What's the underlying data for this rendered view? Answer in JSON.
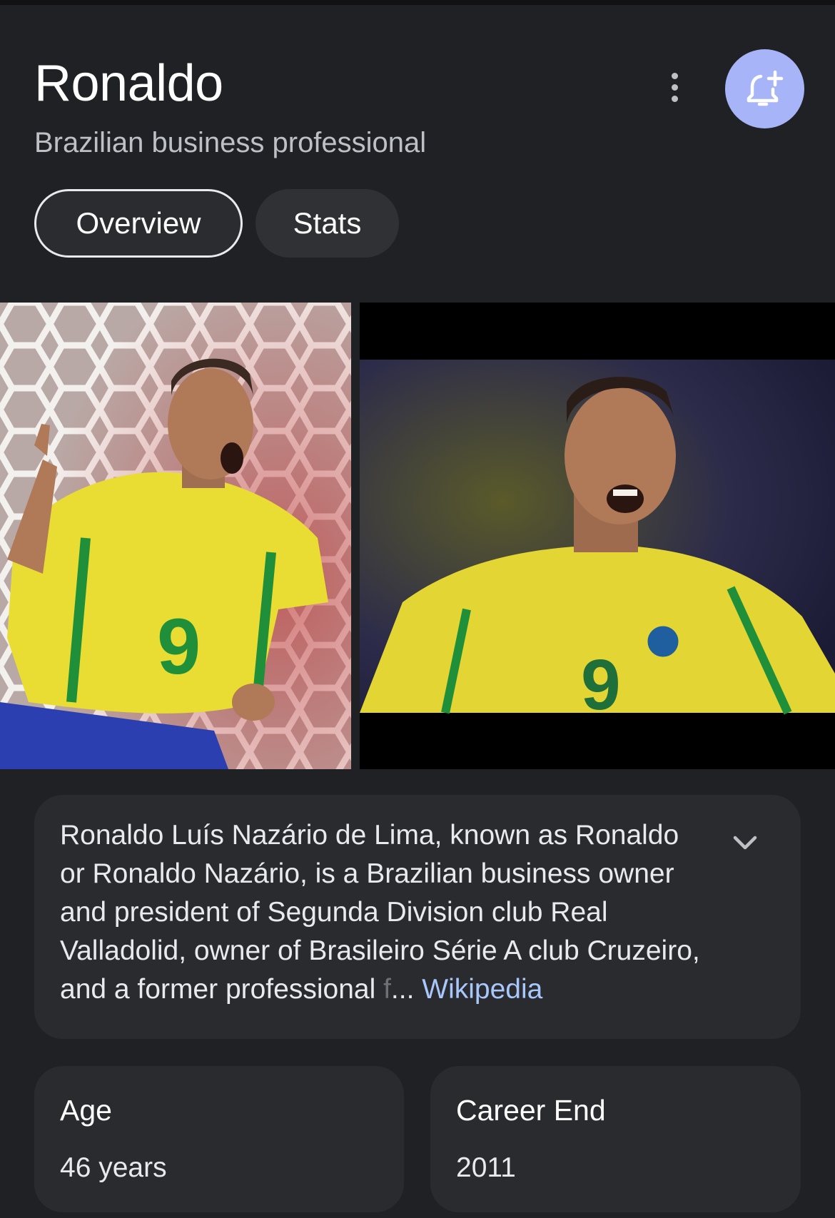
{
  "entity": {
    "title": "Ronaldo",
    "subtitle": "Brazilian business professional"
  },
  "actions": {
    "more_icon": "more-vert-icon",
    "bell_icon": "bell-add-icon",
    "bell_color": "#a8b4f8"
  },
  "tabs": [
    {
      "label": "Overview",
      "selected": true
    },
    {
      "label": "Stats",
      "selected": false
    }
  ],
  "images": [
    {
      "alt": "Ronaldo photo 1"
    },
    {
      "alt": "Ronaldo photo 2"
    }
  ],
  "description": {
    "text": "Ronaldo Luís Nazário de Lima, known as Ronaldo or Ronaldo Nazário, is a Brazilian business owner and president of Segunda Division club Real Valladolid, owner of Brasileiro Série A club Cruzeiro, and a former professional ",
    "faded": "f",
    "ellipsis": "... ",
    "source_link": "Wikipedia"
  },
  "stats": [
    {
      "label": "Age",
      "value": "46 years"
    },
    {
      "label": "Career End",
      "value": "2011"
    }
  ]
}
